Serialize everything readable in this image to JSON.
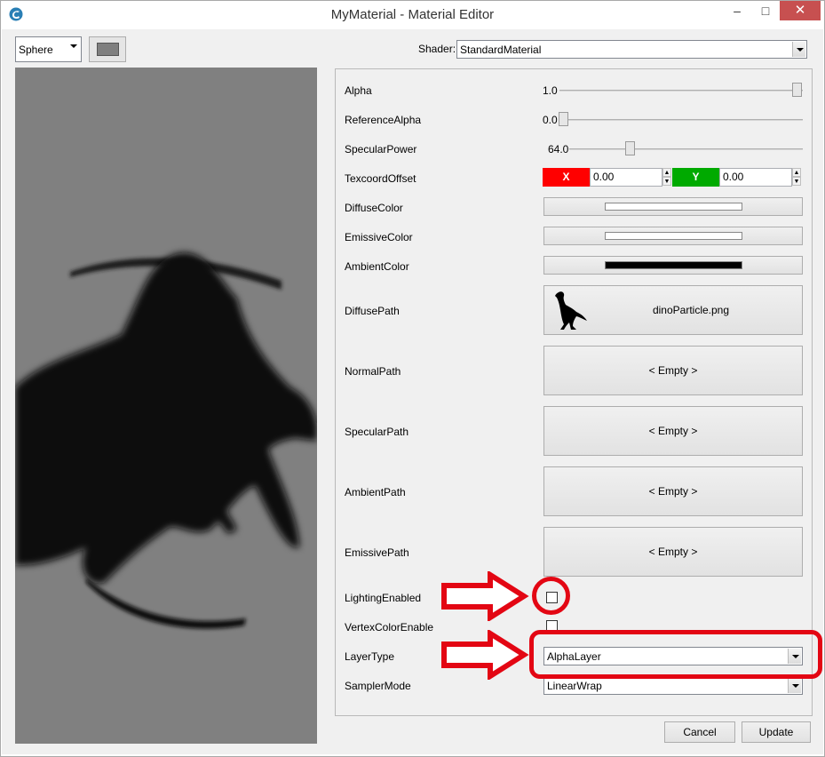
{
  "window": {
    "title": "MyMaterial - Material Editor",
    "minimize_glyph": "–",
    "maximize_glyph": "□",
    "close_glyph": "✕"
  },
  "toolbar": {
    "preview_shape": "Sphere",
    "shader_label": "Shader:",
    "shader_value": "StandardMaterial",
    "background_swatch_color": "#7f7f7f"
  },
  "properties": {
    "alpha": {
      "label": "Alpha",
      "value": "1.0",
      "fraction": 1.0
    },
    "reference_alpha": {
      "label": "ReferenceAlpha",
      "value": "0.0",
      "fraction": 0.0
    },
    "specular_power": {
      "label": "SpecularPower",
      "value": "64.0",
      "fraction": 0.26
    },
    "texcoord_offset": {
      "label": "TexcoordOffset",
      "x_tag": "X",
      "x_value": "0.00",
      "y_tag": "Y",
      "y_value": "0.00",
      "x_color": "#ff0000",
      "y_color": "#00aa00"
    },
    "diffuse_color": {
      "label": "DiffuseColor",
      "color": "#ffffff"
    },
    "emissive_color": {
      "label": "EmissiveColor",
      "color": "#ffffff"
    },
    "ambient_color": {
      "label": "AmbientColor",
      "color": "#000000"
    },
    "diffuse_path": {
      "label": "DiffusePath",
      "value": "dinoParticle.png"
    },
    "normal_path": {
      "label": "NormalPath",
      "value": "< Empty >"
    },
    "specular_path": {
      "label": "SpecularPath",
      "value": "< Empty >"
    },
    "ambient_path": {
      "label": "AmbientPath",
      "value": "< Empty >"
    },
    "emissive_path": {
      "label": "EmissivePath",
      "value": "< Empty >"
    },
    "lighting_enabled": {
      "label": "LightingEnabled",
      "checked": false
    },
    "vertex_color_enable": {
      "label": "VertexColorEnable",
      "checked": false
    },
    "layer_type": {
      "label": "LayerType",
      "value": "AlphaLayer"
    },
    "sampler_mode": {
      "label": "SamplerMode",
      "value": "LinearWrap"
    }
  },
  "buttons": {
    "cancel": "Cancel",
    "update": "Update"
  },
  "annotation": {
    "color": "#e30613"
  }
}
